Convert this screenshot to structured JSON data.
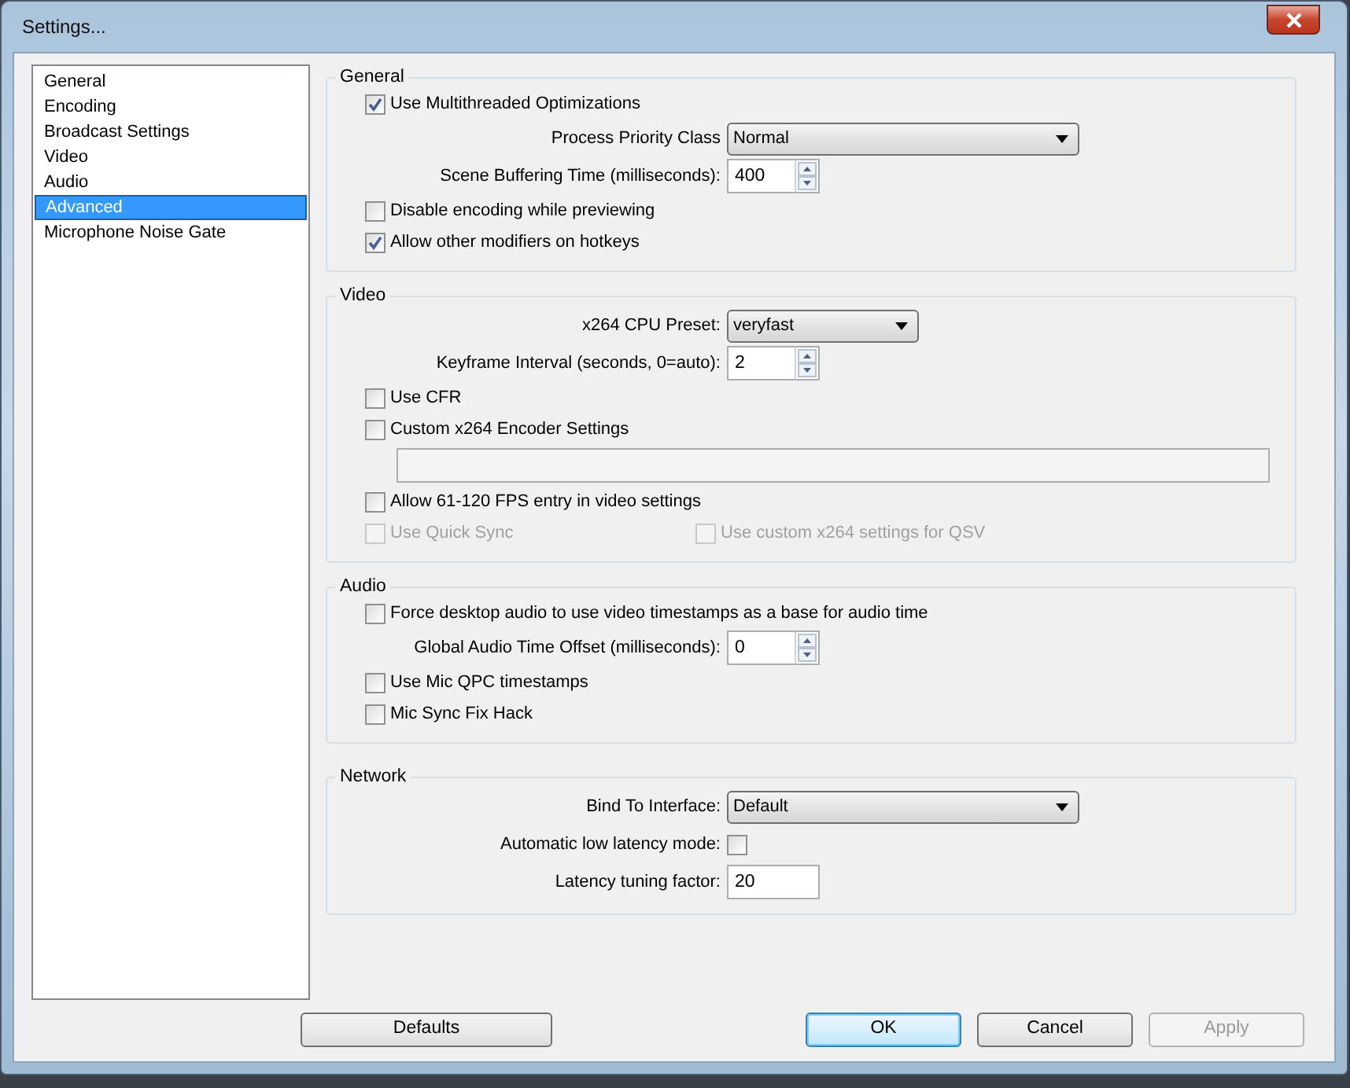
{
  "window": {
    "title": "Settings..."
  },
  "sidebar": {
    "items": [
      {
        "label": "General",
        "selected": false
      },
      {
        "label": "Encoding",
        "selected": false
      },
      {
        "label": "Broadcast Settings",
        "selected": false
      },
      {
        "label": "Video",
        "selected": false
      },
      {
        "label": "Audio",
        "selected": false
      },
      {
        "label": "Advanced",
        "selected": true
      },
      {
        "label": "Microphone Noise Gate",
        "selected": false
      }
    ]
  },
  "groups": [
    {
      "title": "General",
      "items": [
        {
          "kind": "checkbox",
          "label": "Use Multithreaded Optimizations",
          "checked": true,
          "disabled": false
        },
        {
          "kind": "dropdown",
          "label": "Process Priority Class",
          "value": "Normal"
        },
        {
          "kind": "spin",
          "label": "Scene Buffering Time (milliseconds):",
          "value": "400"
        },
        {
          "kind": "checkbox",
          "label": "Disable encoding while previewing",
          "checked": false,
          "disabled": false
        },
        {
          "kind": "checkbox",
          "label": "Allow other modifiers on hotkeys",
          "checked": true,
          "disabled": false
        }
      ]
    },
    {
      "title": "Video",
      "items": [
        {
          "kind": "dropdown",
          "label": "x264 CPU Preset:",
          "value": "veryfast"
        },
        {
          "kind": "spin",
          "label": "Keyframe Interval (seconds, 0=auto):",
          "value": "2"
        },
        {
          "kind": "checkbox",
          "label": "Use CFR",
          "checked": false,
          "disabled": false
        },
        {
          "kind": "checkbox",
          "label": "Custom x264 Encoder Settings",
          "checked": false,
          "disabled": false
        },
        {
          "kind": "textfield"
        },
        {
          "kind": "checkbox",
          "label": "Allow 61-120 FPS entry in video settings",
          "checked": false,
          "disabled": false
        },
        {
          "kind": "pair",
          "items": [
            {
              "label": "Use Quick Sync",
              "checked": false,
              "disabled": true
            },
            {
              "label": "Use custom x264 settings for QSV",
              "checked": false,
              "disabled": true
            }
          ]
        }
      ]
    },
    {
      "title": "Audio",
      "items": [
        {
          "kind": "checkbox",
          "label": "Force desktop audio to use video timestamps as a base for audio time",
          "checked": false,
          "disabled": false
        },
        {
          "kind": "spin",
          "label": "Global Audio Time Offset (milliseconds):",
          "value": "0"
        },
        {
          "kind": "checkbox",
          "label": "Use Mic QPC timestamps",
          "checked": false,
          "disabled": false
        },
        {
          "kind": "checkbox",
          "label": "Mic Sync Fix Hack",
          "checked": false,
          "disabled": false
        }
      ]
    },
    {
      "title": "Network",
      "items": [
        {
          "kind": "dropdown",
          "label": "Bind To Interface:",
          "value": "Default"
        },
        {
          "kind": "labeled_checkbox",
          "label": "Automatic low latency mode:",
          "checked": false
        },
        {
          "kind": "input",
          "label": "Latency tuning factor:",
          "value": "20"
        }
      ]
    }
  ],
  "buttons": [
    {
      "label": "Defaults",
      "default": false,
      "disabled": false
    },
    {
      "label": "OK",
      "default": true,
      "disabled": false
    },
    {
      "label": "Cancel",
      "default": false,
      "disabled": false
    },
    {
      "label": "Apply",
      "default": false,
      "disabled": true
    }
  ]
}
